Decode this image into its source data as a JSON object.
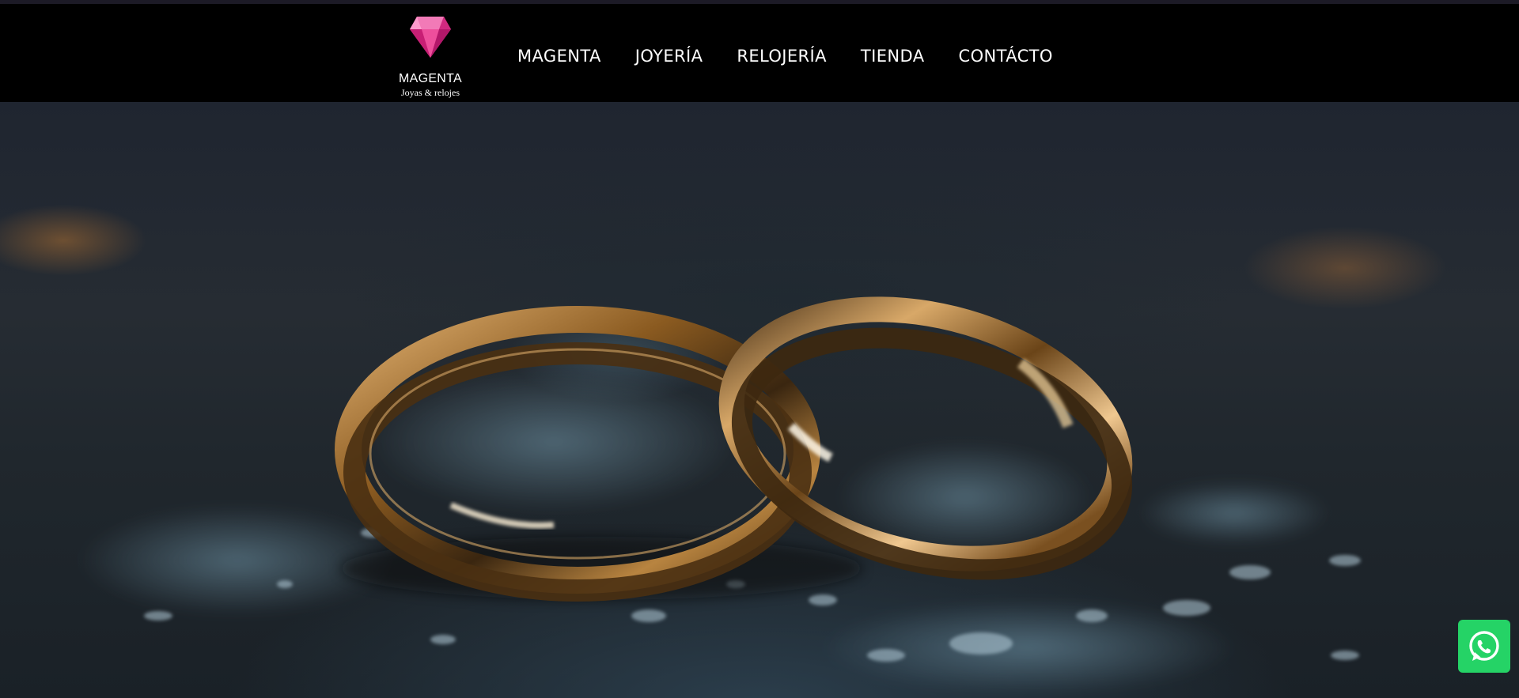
{
  "brand": {
    "name": "MAGENTA",
    "tagline": "Joyas & relojes",
    "logo_icon": "diamond-icon",
    "accent_color": "#e8308a"
  },
  "nav": {
    "items": [
      {
        "label": "MAGENTA"
      },
      {
        "label": "JOYERÍA"
      },
      {
        "label": "RELOJERÍA"
      },
      {
        "label": "TIENDA"
      },
      {
        "label": "CONTÁCTO"
      }
    ]
  },
  "hero": {
    "image": "wedding-rings-photo"
  },
  "floating": {
    "whatsapp_icon": "whatsapp-icon",
    "whatsapp_color": "#25d366"
  }
}
